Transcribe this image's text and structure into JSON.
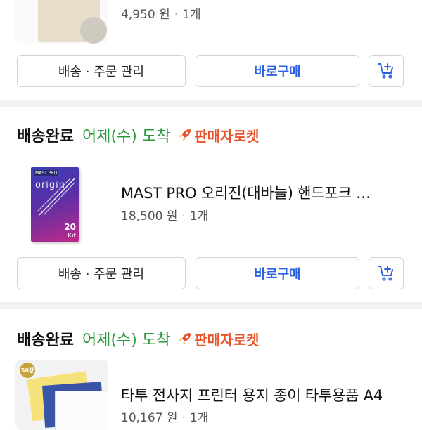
{
  "prev_item": {
    "price": "4,950 원",
    "qty": "1개"
  },
  "buttons": {
    "order_manage": "배송 · 주문 관리",
    "buy_again": "바로구매"
  },
  "orders": [
    {
      "status": "배송완료",
      "arrival": "어제(수) 도착",
      "badge": "판매자로켓",
      "product_name": "MAST PRO 오리진(대바늘) 핸드포크 …",
      "price": "18,500 원",
      "qty": "1개",
      "thumb_brand": "MAST PRO",
      "thumb_title": "origin",
      "thumb_count": "20",
      "thumb_unit": "Kit"
    },
    {
      "status": "배송완료",
      "arrival": "어제(수) 도착",
      "badge": "판매자로켓",
      "product_name": "타투 전사지 프린터 용지 종이 타투용품 A4",
      "price": "10,167 원",
      "qty": "1개",
      "thumb_badge": "50장"
    }
  ],
  "colors": {
    "accent": "#2d63e1",
    "arrival_green": "#2a9a3a",
    "rocket_orange": "#e8532a",
    "divider": "#f1f2f4"
  },
  "icons": [
    "cart-plus-icon",
    "rocket-icon"
  ]
}
